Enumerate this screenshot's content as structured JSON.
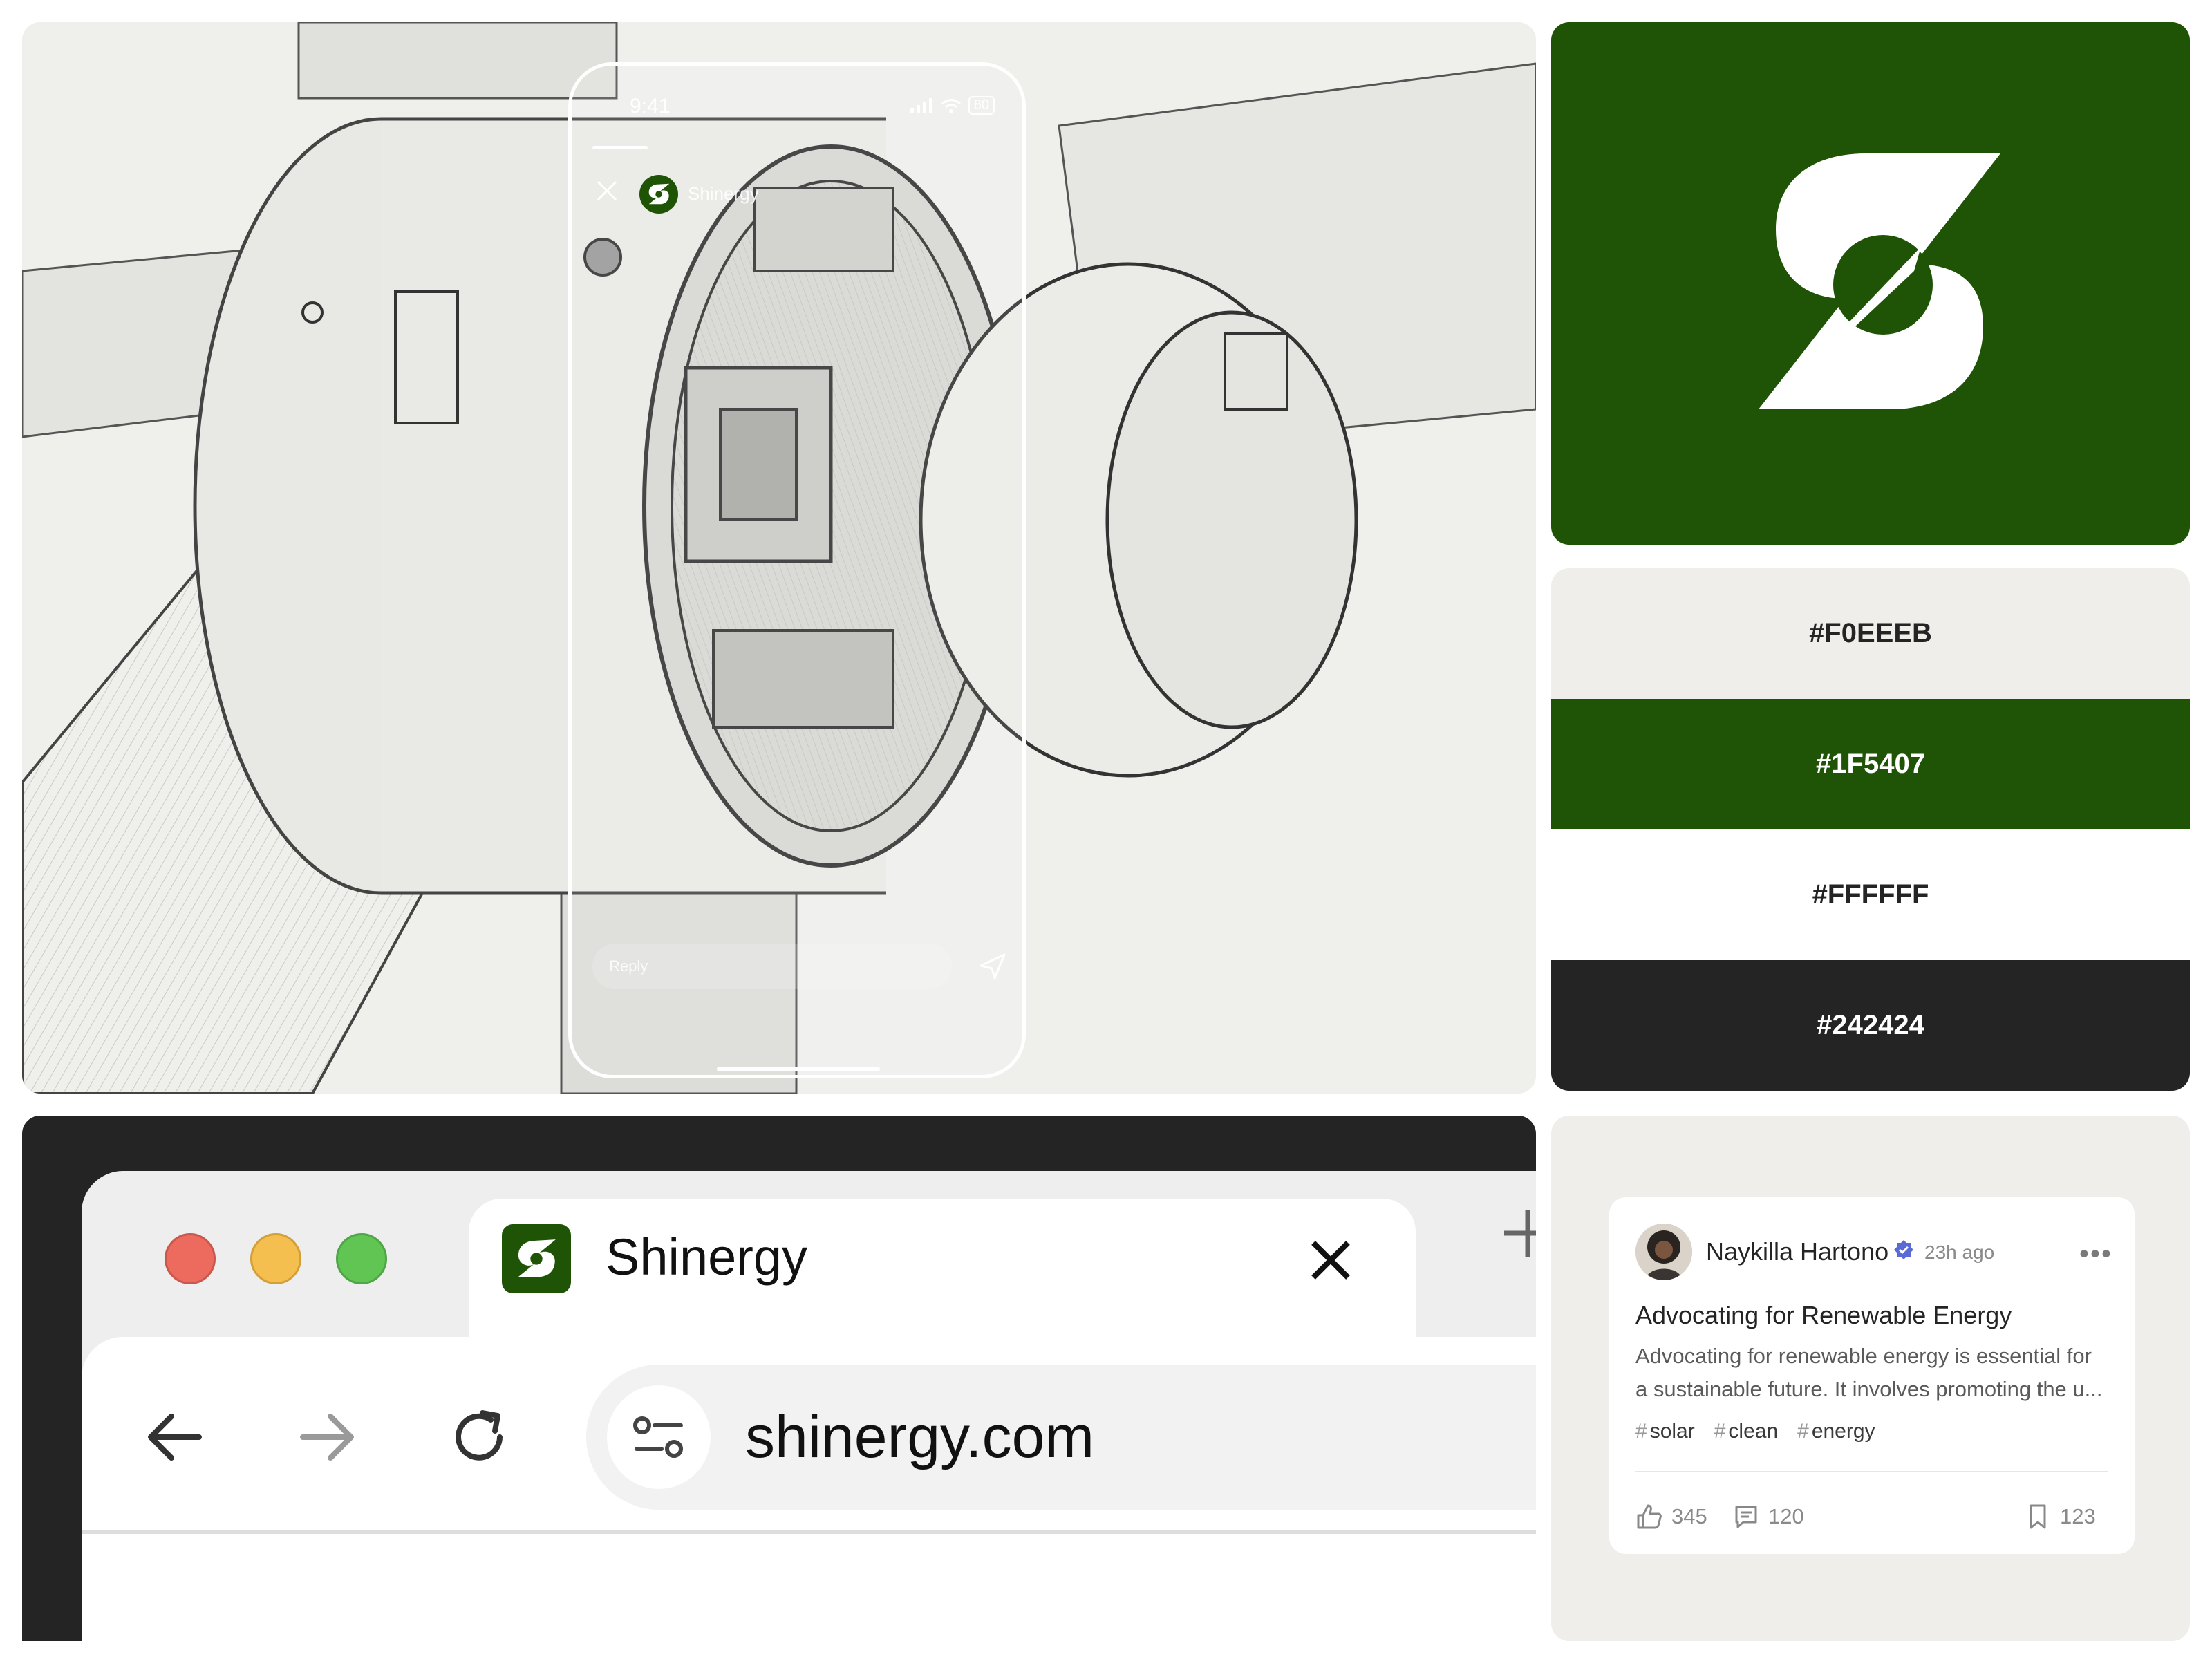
{
  "colors": {
    "brand_green": "#1F5407",
    "cream": "#F0EEEB",
    "white": "#FFFFFF",
    "dark": "#242424",
    "traffic_red": "#EC6A5E",
    "traffic_yellow": "#F4BF4F",
    "traffic_green": "#61C554"
  },
  "phone": {
    "time": "9:41",
    "battery": "80",
    "account_name": "Shinergy",
    "reply_placeholder": "Reply"
  },
  "logo": {
    "icon": "shinergy-s-logo-icon"
  },
  "palette": {
    "swatches": [
      {
        "label": "#F0EEEB",
        "color": "#F0EEEB",
        "text_color": "#242424"
      },
      {
        "label": "#1F5407",
        "color": "#1F5407",
        "text_color": "#FFFFFF"
      },
      {
        "label": "#FFFFFF",
        "color": "#FFFFFF",
        "text_color": "#242424"
      },
      {
        "label": "#242424",
        "color": "#242424",
        "text_color": "#FFFFFF"
      }
    ]
  },
  "browser": {
    "tab_title": "Shinergy",
    "url": "shinergy.com",
    "icons": [
      "close-icon",
      "plus-icon",
      "arrow-left-icon",
      "arrow-right-icon",
      "reload-icon",
      "site-controls-icon"
    ]
  },
  "post": {
    "author": "Naykilla Hartono",
    "time": "23h ago",
    "title": "Advocating for Renewable Energy",
    "body": "Advocating for renewable energy is essential for a sustainable future. It involves promoting the u...",
    "tags": [
      "solar",
      "clean",
      "energy"
    ],
    "likes": "345",
    "comments": "120",
    "saves": "123"
  }
}
